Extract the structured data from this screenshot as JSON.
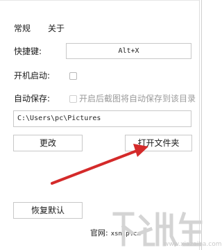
{
  "tabs": {
    "general": "常规",
    "about": "关于"
  },
  "settings": {
    "hotkey_label": "快捷键:",
    "hotkey_value": "Alt+X",
    "startup_label": "开机启动:",
    "startup_checked": false,
    "autosave_label": "自动保存:",
    "autosave_checked": false,
    "autosave_option": "开启后截图将自动保存到该目录",
    "save_path": "C:\\Users\\pc\\Pictures"
  },
  "buttons": {
    "change": "更改",
    "open_folder": "打开文件夹",
    "restore_defaults": "恢复默认"
  },
  "footer": {
    "official_label": "官网:",
    "official_site": "xsnip.cn"
  },
  "watermark": {
    "site": "www.xiazaiba.com"
  },
  "colors": {
    "arrow": "#d42a2a",
    "border": "#c8c8c8",
    "disabled_text": "#9b9b9b"
  }
}
